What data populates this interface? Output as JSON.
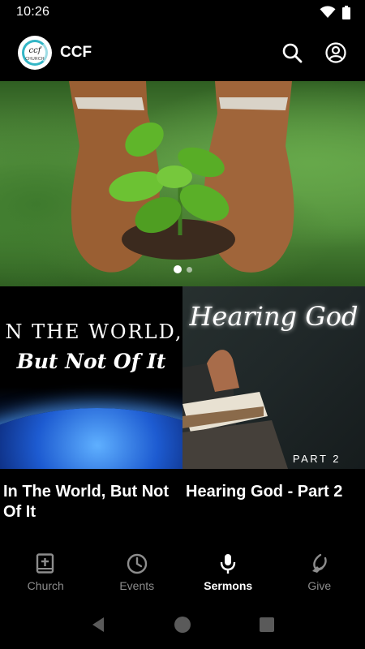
{
  "status_bar": {
    "time": "10:26"
  },
  "app_bar": {
    "logo_text": "ccf",
    "logo_subtext": "CHURCH",
    "title": "CCF"
  },
  "hero": {
    "slides": 2,
    "active_slide": 1
  },
  "sermons": [
    {
      "thumb_line1": "N THE WORLD,",
      "thumb_line2": "But Not Of It",
      "title": "In The World, But Not Of It"
    },
    {
      "thumb_script": "Hearing God",
      "thumb_part": "PART 2",
      "title": "Hearing God - Part 2"
    }
  ],
  "bottom_nav": [
    {
      "label": "Church",
      "icon": "bible-icon"
    },
    {
      "label": "Events",
      "icon": "clock-icon"
    },
    {
      "label": "Sermons",
      "icon": "microphone-icon",
      "active": true
    },
    {
      "label": "Give",
      "icon": "give-icon"
    }
  ],
  "colors": {
    "background": "#000000",
    "active": "#ffffff",
    "inactive": "#8d8d8d",
    "logo_accent": "#34b6c6"
  }
}
